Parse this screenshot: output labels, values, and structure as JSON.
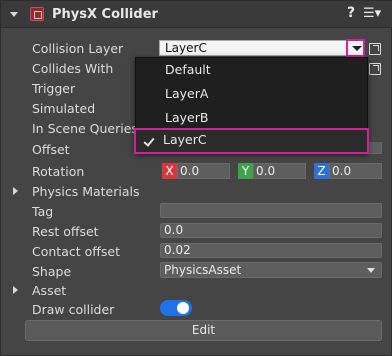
{
  "header": {
    "title": "PhysX Collider",
    "help_label": "?",
    "menu_label": "☰▾"
  },
  "fields": {
    "collision_layer": {
      "label": "Collision Layer",
      "value": "LayerC"
    },
    "collides_with": {
      "label": "Collides With"
    },
    "trigger": {
      "label": "Trigger"
    },
    "simulated": {
      "label": "Simulated"
    },
    "in_scene_queries": {
      "label": "In Scene Queries"
    },
    "offset": {
      "label": "Offset"
    },
    "rotation": {
      "label": "Rotation",
      "x_tag": "X",
      "x_value": "0.0",
      "y_tag": "Y",
      "y_value": "0.0",
      "z_tag": "Z",
      "z_value": "0.0"
    },
    "physics_materials": {
      "label": "Physics Materials"
    },
    "tag": {
      "label": "Tag",
      "value": ""
    },
    "rest_offset": {
      "label": "Rest offset",
      "value": "0.0"
    },
    "contact_offset": {
      "label": "Contact offset",
      "value": "0.02"
    },
    "shape": {
      "label": "Shape",
      "value": "PhysicsAsset"
    },
    "asset": {
      "label": "Asset"
    },
    "draw_collider": {
      "label": "Draw collider",
      "enabled": true
    }
  },
  "dropdown": {
    "items": [
      "Default",
      "LayerA",
      "LayerB",
      "LayerC"
    ],
    "selected": "LayerC"
  },
  "edit_button": "Edit",
  "colors": {
    "highlight": "#d0219a",
    "toggle_on": "#1e73e8",
    "x_axis": "#d9363e",
    "y_axis": "#3fa34d",
    "z_axis": "#2f6fd9"
  }
}
